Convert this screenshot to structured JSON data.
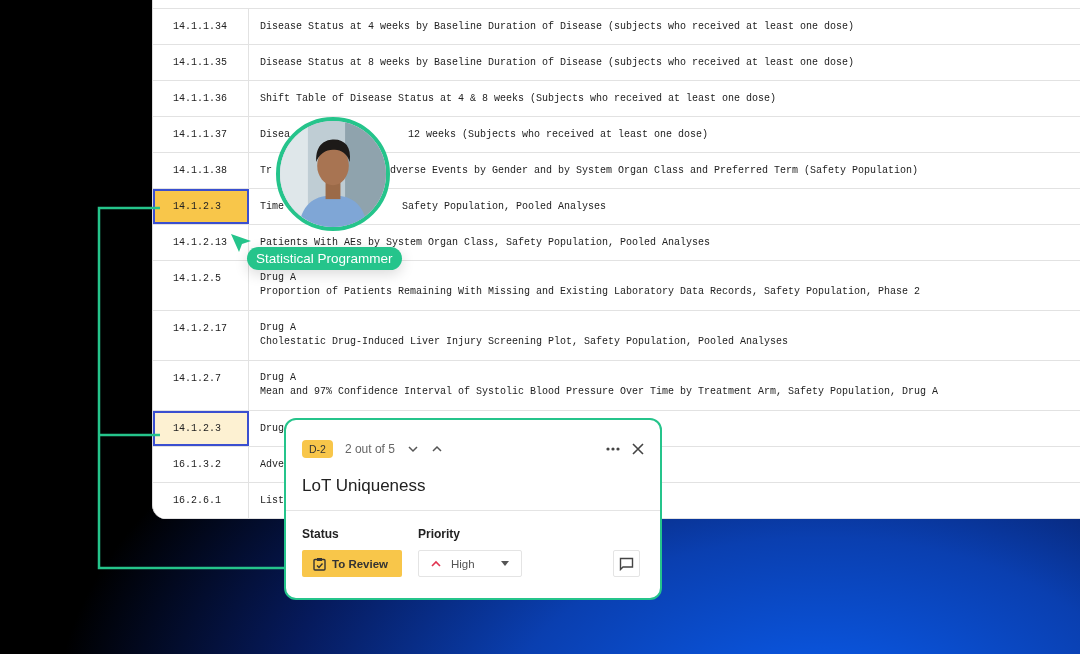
{
  "table": {
    "rows": [
      {
        "id": "14.1.1.34",
        "lines": [
          [
            "Disease Status at 4 weeks by Baseline Duration of Disease (subjects who received at least one dose)"
          ]
        ],
        "selected": false
      },
      {
        "id": "14.1.1.35",
        "lines": [
          [
            "Disease Status at 8 weeks by Baseline Duration of Disease (subjects who received at least one dose)"
          ]
        ],
        "selected": false
      },
      {
        "id": "14.1.1.36",
        "lines": [
          [
            "Shift Table of Disease Status at 4 & 8 weeks (Subjects who received at least one dose)"
          ]
        ],
        "selected": false
      },
      {
        "id": "14.1.1.37",
        "lines": [
          [
            "Disea",
            "12 weeks (Subjects who received at least one dose)"
          ]
        ],
        "selected": false
      },
      {
        "id": "14.1.1.38",
        "lines": [
          [
            "Tr",
            "dverse Events by Gender and by System Organ Class and Preferred Term (Safety Population)"
          ]
        ],
        "selected": false
      },
      {
        "id": "14.1.2.3",
        "lines": [
          [
            "Time",
            "Safety Population, Pooled Analyses"
          ]
        ],
        "selected": true,
        "color": "#f8c64a"
      },
      {
        "id": "14.1.2.13",
        "lines": [
          [
            "Patients With AEs by System Organ Class, Safety Population, Pooled Analyses"
          ]
        ],
        "selected": false
      },
      {
        "id": "14.1.2.5",
        "lines": [
          [
            "Drug A"
          ],
          [
            "Proportion of Patients Remaining With Missing and Existing Laboratory Data Records, Safety Population, Phase 2"
          ]
        ],
        "selected": false
      },
      {
        "id": "14.1.2.17",
        "lines": [
          [
            "Drug A"
          ],
          [
            "Cholestatic Drug-Induced Liver Injury Screening Plot, Safety Population, Pooled Analyses"
          ]
        ],
        "selected": false
      },
      {
        "id": "14.1.2.7",
        "lines": [
          [
            "Drug A"
          ],
          [
            "Mean and 97% Confidence Interval of Systolic Blood Pressure Over Time by Treatment Arm, Safety Population, Drug A"
          ]
        ],
        "selected": false
      },
      {
        "id": "14.1.2.3",
        "lines": [
          [
            "Drug"
          ]
        ],
        "selected": true,
        "color": "#fdf1d2"
      },
      {
        "id": "16.1.3.2",
        "lines": [
          [
            "Adve"
          ]
        ],
        "selected": false
      },
      {
        "id": "16.2.6.1",
        "lines": [
          [
            "List"
          ]
        ],
        "selected": false
      }
    ]
  },
  "avatar": {
    "kind": "picture",
    "role": "Statistical Programmer"
  },
  "popup": {
    "badge": "D-2",
    "counter": "2 out of 5",
    "title": "LoT Uniqueness",
    "status": {
      "label": "Status",
      "value": "To Review"
    },
    "priority": {
      "label": "Priority",
      "value": "High"
    }
  }
}
